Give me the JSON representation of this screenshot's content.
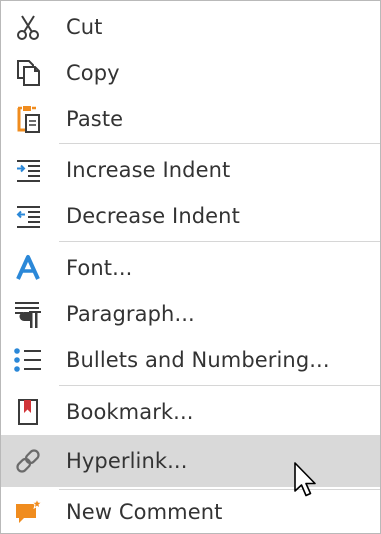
{
  "menu": {
    "items": [
      {
        "label": "Cut",
        "icon": "scissors-icon"
      },
      {
        "label": "Copy",
        "icon": "copy-icon"
      },
      {
        "label": "Paste",
        "icon": "paste-icon"
      },
      {
        "label": "Increase Indent",
        "icon": "increase-indent-icon"
      },
      {
        "label": "Decrease Indent",
        "icon": "decrease-indent-icon"
      },
      {
        "label": "Font...",
        "icon": "font-icon"
      },
      {
        "label": "Paragraph...",
        "icon": "paragraph-icon"
      },
      {
        "label": "Bullets and Numbering...",
        "icon": "bullets-icon"
      },
      {
        "label": "Bookmark...",
        "icon": "bookmark-icon"
      },
      {
        "label": "Hyperlink...",
        "icon": "link-icon",
        "highlighted": true
      },
      {
        "label": "New Comment",
        "icon": "comment-icon"
      }
    ]
  },
  "colors": {
    "accent_orange": "#f08c1e",
    "accent_blue": "#2b88d8",
    "bookmark_red": "#d13438",
    "hover_background": "#d9d9d9",
    "icon_gray": "#3b3b3b"
  }
}
